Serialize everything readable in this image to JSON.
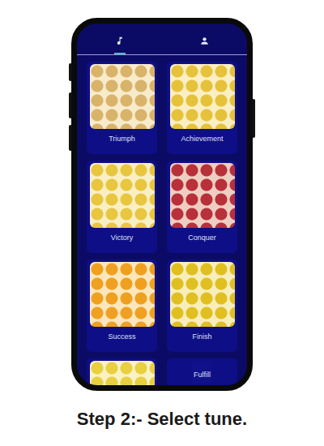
{
  "tabs": [
    {
      "kind": "music",
      "selected": true
    },
    {
      "kind": "profile",
      "selected": false
    }
  ],
  "tunes": [
    {
      "label": "Triumph",
      "kind": "full",
      "color": "#d9b36a"
    },
    {
      "label": "Achievement",
      "kind": "full",
      "color": "#e6c23a"
    },
    {
      "label": "Victory",
      "kind": "full",
      "color": "#e8c640"
    },
    {
      "label": "Conquer",
      "kind": "full",
      "color": "#b8303a"
    },
    {
      "label": "Success",
      "kind": "full",
      "color": "#f0a020"
    },
    {
      "label": "Finish",
      "kind": "full",
      "color": "#e0c020"
    },
    {
      "label": "",
      "kind": "image-only",
      "color": "#e8d040"
    },
    {
      "label": "Fulfill",
      "kind": "label-only",
      "color": "#10108a"
    }
  ],
  "caption": "Step 2:- Select tune."
}
